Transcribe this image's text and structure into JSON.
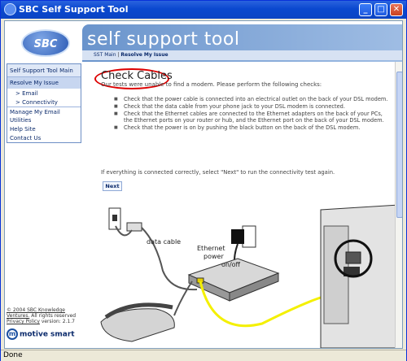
{
  "window": {
    "title": "SBC Self Support Tool",
    "status": "Done"
  },
  "header": {
    "title": "self support tool",
    "logo_text": "SBC",
    "crumb_main": "SST Main",
    "crumb_sep": "|",
    "crumb_current": "Resolve My Issue"
  },
  "menu": {
    "items": [
      "Self Support Tool Main",
      "Resolve My Issue",
      "> Email",
      "> Connectivity",
      "Manage My Email",
      "Utilities",
      "Help Site",
      "Contact Us"
    ]
  },
  "footer": {
    "copyright": "© 2004 SBC Knowledge",
    "ventures": "Ventures.",
    "rights": "All rights reserved",
    "privacy": "Privacy Policy",
    "version": "version: 2.1.7",
    "brand": "motive smart"
  },
  "content": {
    "heading": "Check Cables",
    "intro": "Our tests were unable to find a modem. Please perform the following checks:",
    "checks": [
      "Check that the power cable is connected into an electrical outlet on the back of your DSL modem.",
      "Check that the data cable from your phone jack to your DSL modem is connected.",
      "Check that the Ethernet cables are connected to the Ethernet adapters on the back of your PCs, the Ethernet ports on your router or hub, and the Ethernet port on the back of your DSL modem.",
      "Check that the power is on by pushing the black button on the back of the DSL modem."
    ],
    "after": "If everything is connected correctly, select \"Next\" to run the connectivity test again.",
    "next_label": "Next",
    "diagram_labels": {
      "data_cable": "data cable",
      "ethernet": "Ethernet",
      "power": "power",
      "onoff": "on/off"
    }
  },
  "colors": {
    "titlebar": "#0a48cf",
    "header_band": "#6a94cc",
    "highlight_oval": "#dd0000",
    "cable_yellow": "#f4f000"
  }
}
